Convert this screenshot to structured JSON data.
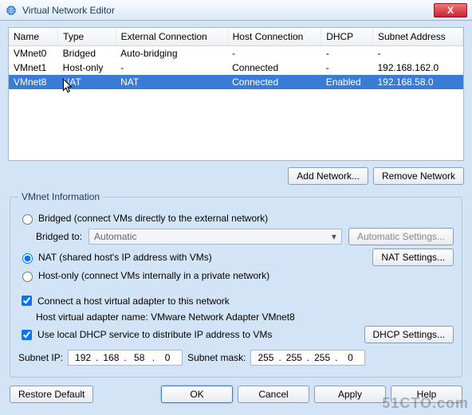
{
  "window": {
    "title": "Virtual Network Editor",
    "close": "X"
  },
  "table": {
    "headers": [
      "Name",
      "Type",
      "External Connection",
      "Host Connection",
      "DHCP",
      "Subnet Address"
    ],
    "rows": [
      {
        "name": "VMnet0",
        "type": "Bridged",
        "ext": "Auto-bridging",
        "host": "-",
        "dhcp": "-",
        "subnet": "-"
      },
      {
        "name": "VMnet1",
        "type": "Host-only",
        "ext": "-",
        "host": "Connected",
        "dhcp": "-",
        "subnet": "192.168.162.0"
      },
      {
        "name": "VMnet8",
        "type": "NAT",
        "ext": "NAT",
        "host": "Connected",
        "dhcp": "Enabled",
        "subnet": "192.168.58.0"
      }
    ]
  },
  "buttons": {
    "add_network": "Add Network...",
    "remove_network": "Remove Network",
    "automatic_settings": "Automatic Settings...",
    "nat_settings": "NAT Settings...",
    "dhcp_settings": "DHCP Settings...",
    "restore_default": "Restore Default",
    "ok": "OK",
    "cancel": "Cancel",
    "apply": "Apply",
    "help": "Help"
  },
  "info": {
    "legend": "VMnet Information",
    "bridged_label": "Bridged (connect VMs directly to the external network)",
    "bridged_to_label": "Bridged to:",
    "bridged_to_value": "Automatic",
    "nat_label": "NAT (shared host's IP address with VMs)",
    "hostonly_label": "Host-only (connect VMs internally in a private network)",
    "connect_host_label": "Connect a host virtual adapter to this network",
    "host_adapter_line": "Host virtual adapter name: VMware Network Adapter VMnet8",
    "use_dhcp_label": "Use local DHCP service to distribute IP address to VMs",
    "subnet_ip_label": "Subnet IP:",
    "subnet_mask_label": "Subnet mask:",
    "subnet_ip": [
      "192",
      "168",
      "58",
      "0"
    ],
    "subnet_mask": [
      "255",
      "255",
      "255",
      "0"
    ]
  },
  "watermark": "51CTO.com"
}
